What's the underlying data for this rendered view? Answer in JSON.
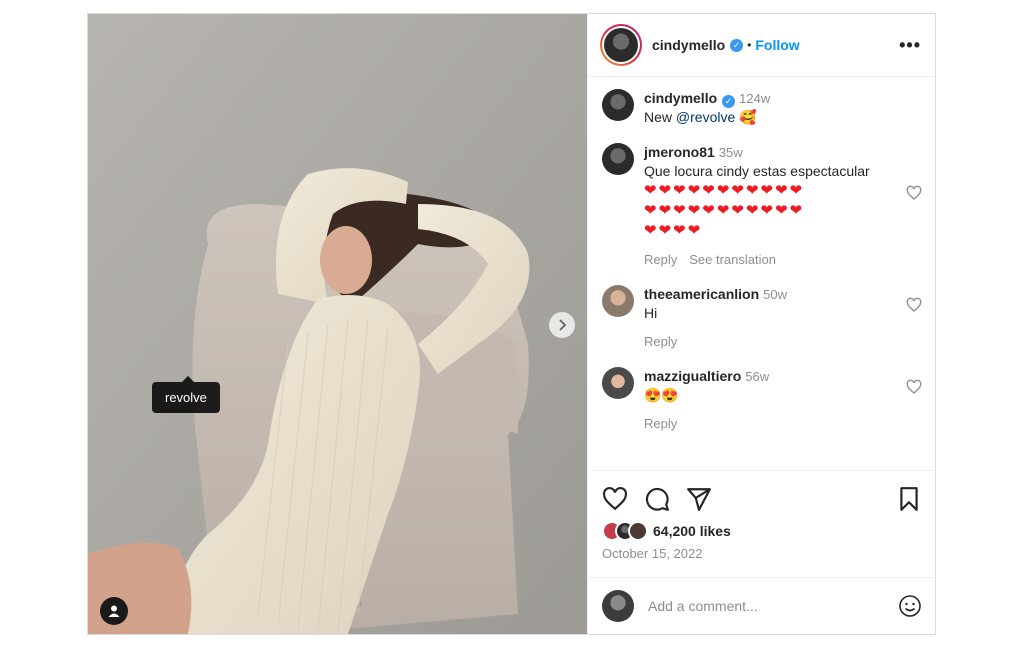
{
  "media": {
    "tag_label": "revolve",
    "next_icon": "chevron-right-icon",
    "user_tag_icon": "user-icon"
  },
  "header": {
    "username": "cindymello",
    "separator": "•",
    "follow_label": "Follow",
    "more_label": "•••"
  },
  "caption": {
    "username": "cindymello",
    "time": "124w",
    "text_prefix": "New ",
    "mention": "@revolve",
    "emoji": "🥰"
  },
  "comments": [
    {
      "username": "jmerono81",
      "time": "35w",
      "text": "Que locura cindy estas espectacular",
      "hearts_line1": "❤❤❤❤❤❤❤❤❤❤❤",
      "hearts_line2": "❤❤❤❤❤❤❤❤❤❤❤",
      "hearts_line3": "❤❤❤❤",
      "reply_label": "Reply",
      "translate_label": "See translation"
    },
    {
      "username": "theeamericanlion",
      "time": "50w",
      "text": "Hi",
      "reply_label": "Reply"
    },
    {
      "username": "mazzigualtiero",
      "time": "56w",
      "text": "😍😍",
      "reply_label": "Reply"
    }
  ],
  "actions": {
    "icons": [
      "heart-icon",
      "comment-icon",
      "share-icon",
      "bookmark-icon"
    ],
    "likes": "64,200 likes",
    "date": "October 15, 2022"
  },
  "add_comment": {
    "placeholder": "Add a comment...",
    "emoji_icon": "smiley-icon"
  },
  "colors": {
    "accent": "#0095f6",
    "verified": "#3897f0",
    "heart": "#ed1c24",
    "muted_text": "#8e8e8e"
  }
}
